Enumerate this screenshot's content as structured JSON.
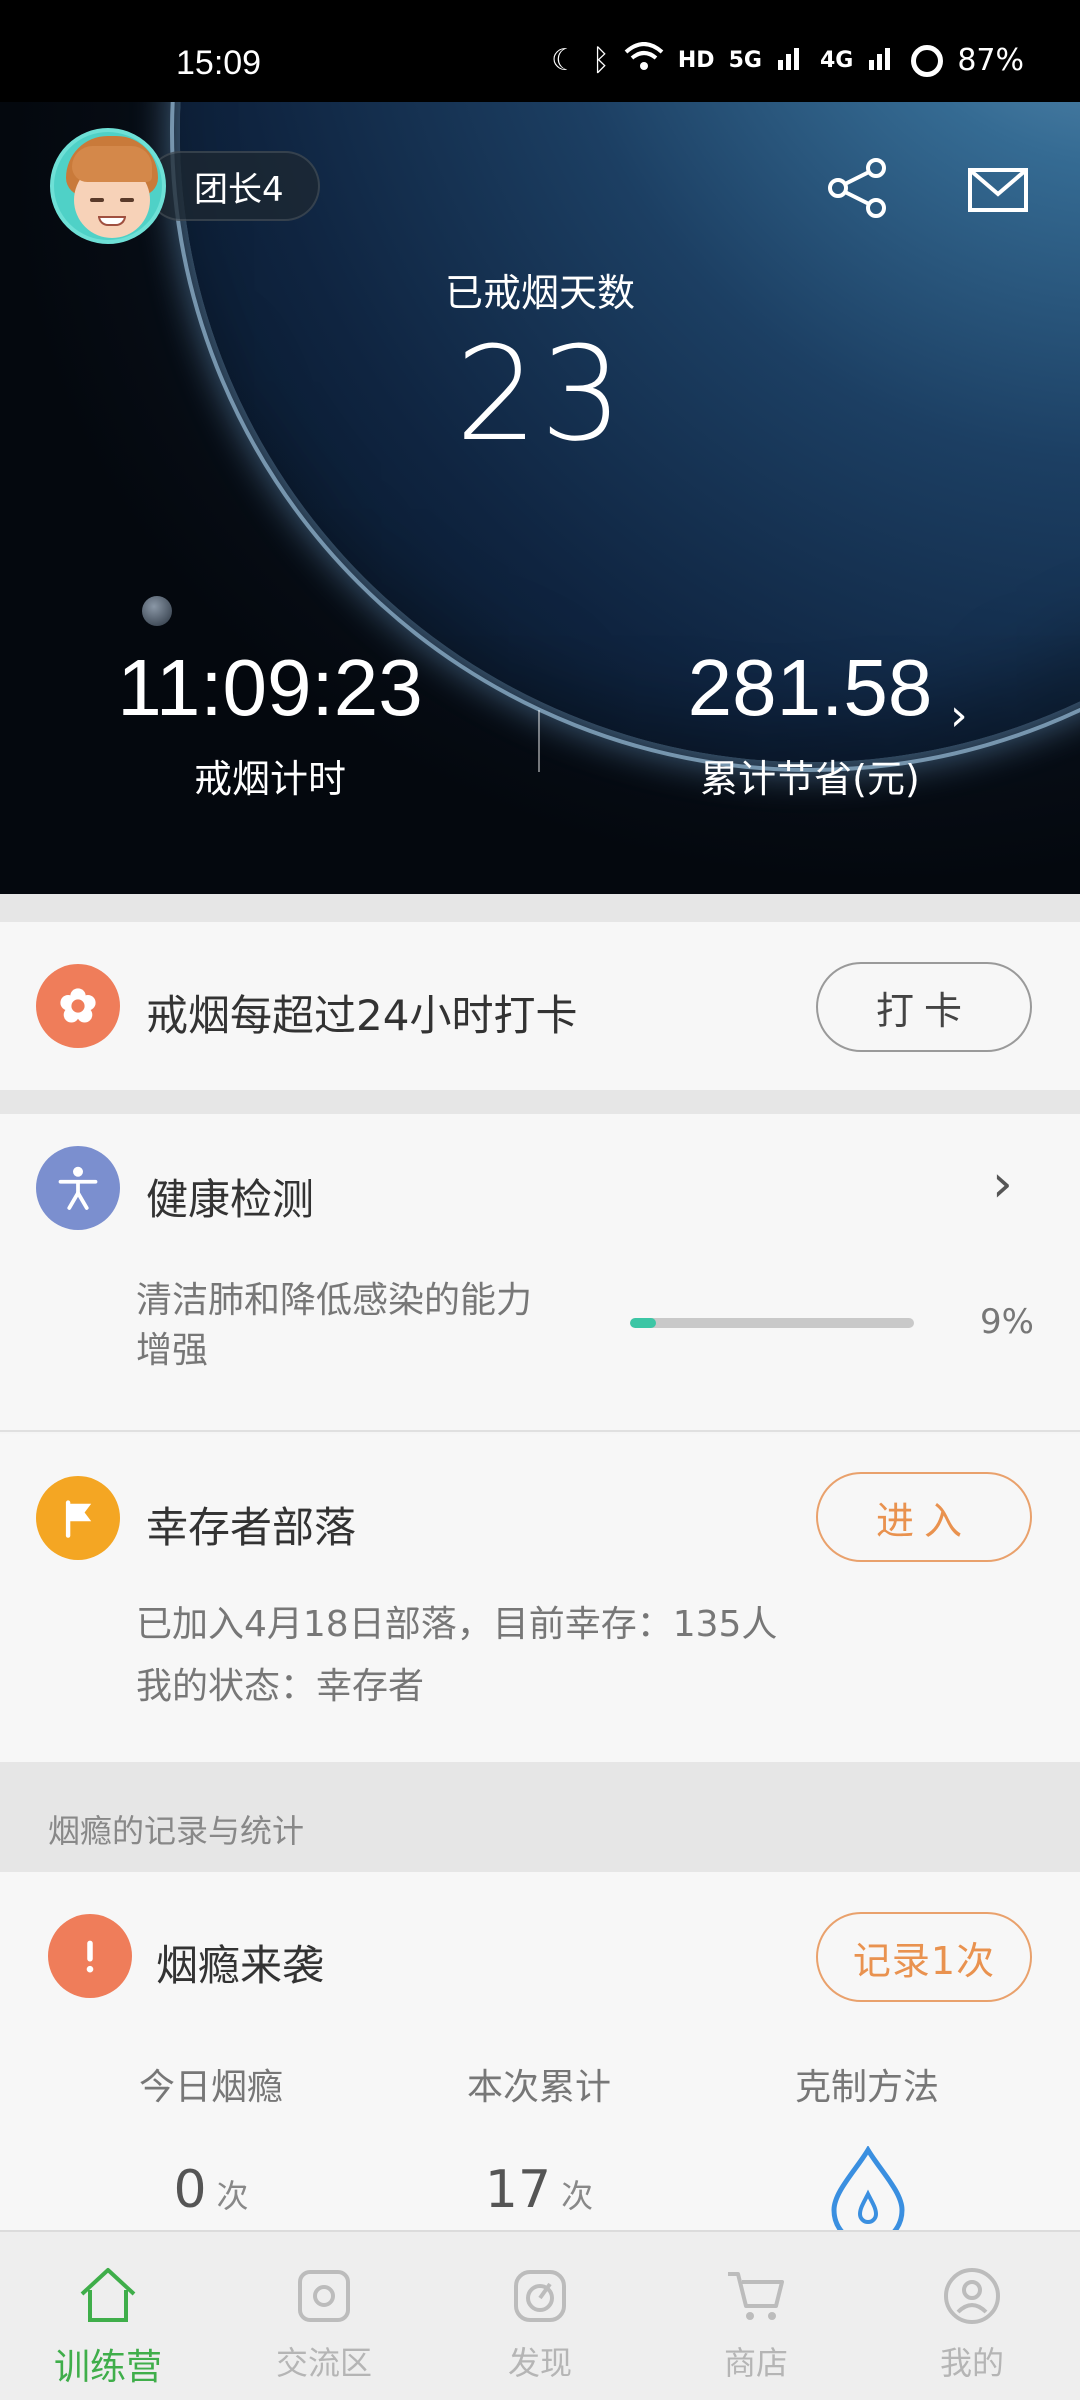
{
  "status_bar": {
    "time": "15:09",
    "battery": "87%",
    "icons": [
      "moon-icon",
      "bluetooth-icon",
      "wifi-icon",
      "hd-icon",
      "5g-signal-icon",
      "4g-signal-icon",
      "battery-icon"
    ],
    "hd_label": "HD",
    "net1": "5G",
    "net2": "4G"
  },
  "hero": {
    "user_name": "团长4",
    "days_label": "已戒烟天数",
    "days_value": "23",
    "timer_value": "11:09:23",
    "timer_label": "戒烟计时",
    "savings_value": "281.58",
    "savings_label": "累计节省(元)",
    "savings_chevron": "›"
  },
  "checkin": {
    "title": "戒烟每超过24小时打卡",
    "button": "打卡",
    "icon": "flower-icon",
    "icon_color": "#ef7d5a"
  },
  "health": {
    "title": "健康检测",
    "chevron": "›",
    "desc_line1": "清洁肺和降低感染的能力",
    "desc_line2": "增强",
    "progress": 0.09,
    "progress_label": "9%",
    "icon": "person-icon",
    "icon_color": "#7b8fcf",
    "accent": "#3cc6a5"
  },
  "tribe": {
    "title": "幸存者部落",
    "button": "进入",
    "line1": "已加入4月18日部落，目前幸存：135人",
    "line2": "我的状态：幸存者",
    "icon": "flag-icon",
    "icon_color": "#f4a623"
  },
  "section": {
    "title": "烟瘾的记录与统计"
  },
  "craving": {
    "title": "烟瘾来袭",
    "button": "记录1次",
    "icon": "exclamation-icon",
    "icon_color": "#ef7d5a",
    "col1_label": "今日烟瘾",
    "col2_label": "本次累计",
    "col3_label": "克制方法",
    "today_count": "0",
    "total_count": "17",
    "unit": "次"
  },
  "nav": {
    "items": [
      {
        "label": "训练营",
        "icon": "home-icon",
        "active": true
      },
      {
        "label": "交流区",
        "icon": "chat-icon",
        "active": false
      },
      {
        "label": "发现",
        "icon": "compass-icon",
        "active": false
      },
      {
        "label": "商店",
        "icon": "cart-icon",
        "active": false
      },
      {
        "label": "我的",
        "icon": "profile-icon",
        "active": false
      }
    ],
    "active_color": "#3fae4a"
  }
}
